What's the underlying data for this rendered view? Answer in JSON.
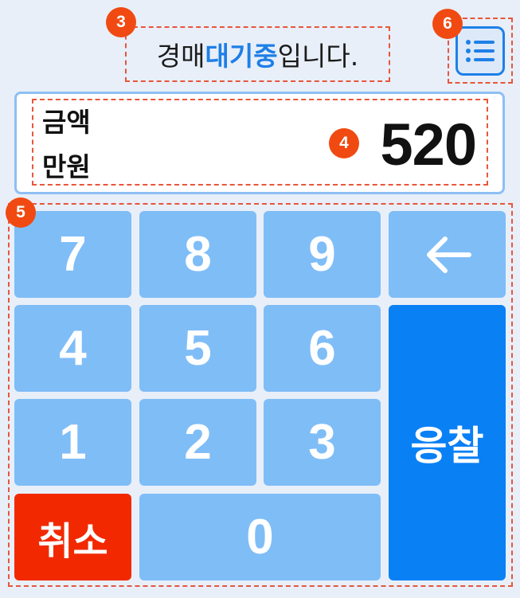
{
  "status": {
    "prefix": "경매 ",
    "highlight": "대기중",
    "suffix": "입니다."
  },
  "menu": {
    "icon": "list-icon"
  },
  "amount": {
    "label_line1": "금액",
    "label_line2": "만원",
    "value": "520"
  },
  "keypad": {
    "k7": "7",
    "k8": "8",
    "k9": "9",
    "back_icon": "arrow-left-icon",
    "k4": "4",
    "k5": "5",
    "k6": "6",
    "k1": "1",
    "k2": "2",
    "k3": "3",
    "k0": "0",
    "cancel": "취소",
    "bid": "응찰"
  },
  "annotations": {
    "m3": "3",
    "m4": "4",
    "m5": "5",
    "m6": "6"
  },
  "colors": {
    "background": "#e8eff9",
    "key": "#7fbdf7",
    "bid": "#0a80f5",
    "cancel": "#f22900",
    "highlight": "#1e7fe6",
    "annotation": "#f04a12"
  }
}
